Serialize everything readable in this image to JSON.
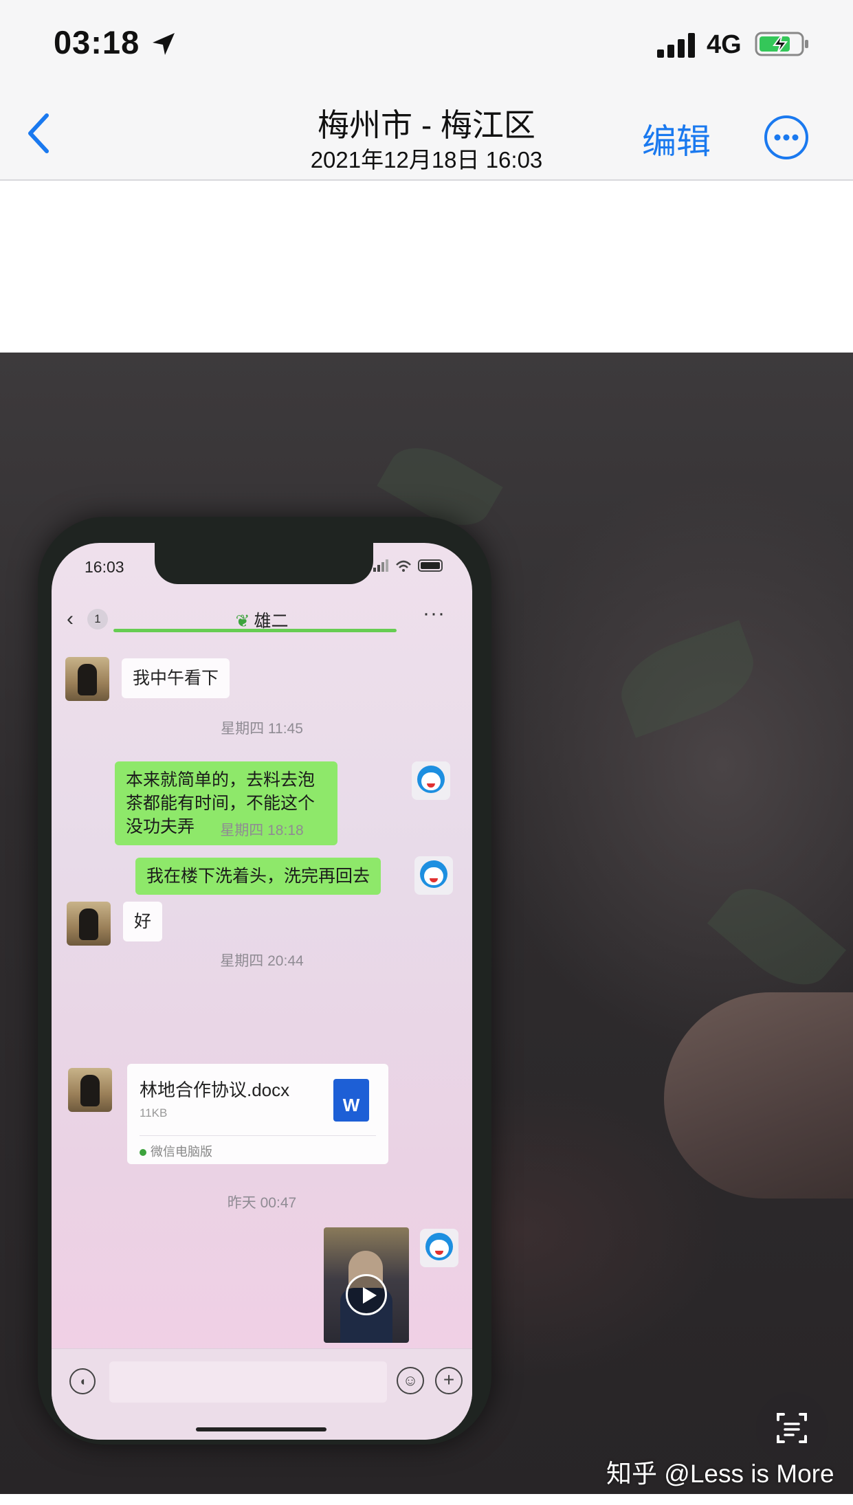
{
  "status_bar": {
    "time": "03:18",
    "network": "4G",
    "battery_level": 0.75,
    "battery_color": "#34c759"
  },
  "header": {
    "title": "梅州市 - 梅江区",
    "subtitle": "2021年12月18日  16:03",
    "edit_label": "编辑",
    "accent_color": "#1a79ef"
  },
  "phone": {
    "status_time": "16:03",
    "chat": {
      "unread_count": "1",
      "contact_name": "雄二"
    },
    "messages": [
      {
        "direction": "in",
        "text": "我中午看下"
      },
      {
        "timestamp": "星期四 11:45"
      },
      {
        "direction": "out",
        "text": "本来就简单的，去料去泡茶都能有时间，不能这个没功夫弄"
      },
      {
        "timestamp": "星期四 18:18"
      },
      {
        "direction": "out",
        "text": "我在楼下洗着头，洗完再回去"
      },
      {
        "direction": "in",
        "text": "好"
      },
      {
        "timestamp": "星期四 20:44"
      },
      {
        "direction": "in",
        "file_name": "林地合作协议.docx",
        "file_size": "11KB",
        "file_icon": "W",
        "source": "微信电脑版"
      },
      {
        "timestamp": "昨天 00:47"
      },
      {
        "direction": "out",
        "type": "video"
      }
    ],
    "bubble_out_color": "#8ee86a"
  },
  "watermark": "知乎 @Less is More"
}
